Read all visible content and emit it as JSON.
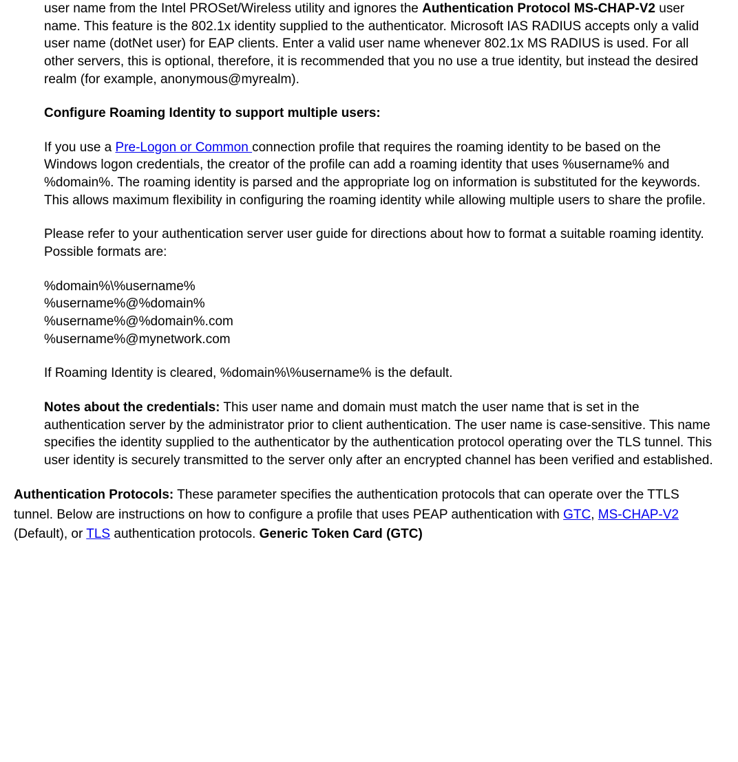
{
  "para1": {
    "before_bold": "user name from the Intel PROSet/Wireless utility and ignores the ",
    "bold": "Authentication Protocol MS-CHAP-V2",
    "after_bold": " user name. This feature is the 802.1x identity supplied to the authenticator. Microsoft IAS RADIUS accepts only a valid user name (dotNet user) for EAP clients. Enter a valid user name whenever 802.1x MS RADIUS is used. For all other servers, this is optional, therefore, it is recommended that you no use a true identity, but instead the desired realm (for example, anonymous@myrealm)."
  },
  "heading_roaming": "Configure Roaming Identity to support multiple users:",
  "para2": {
    "before_link": "If you use a ",
    "link_text": "Pre-Logon or Common ",
    "after_link": "connection profile that requires the roaming identity to be based on the Windows logon credentials, the creator of the profile can add a roaming identity that uses %username% and %domain%. The roaming identity is parsed and the appropriate log on information is substituted for the keywords.  This allows maximum flexibility in configuring the roaming identity while allowing multiple users to share the profile."
  },
  "para3": "Please refer to your authentication server user guide for directions about how to format a suitable roaming identity.  Possible formats are:",
  "formats": {
    "f1": "%domain%\\%username%",
    "f2": "%username%@%domain%",
    "f3": "%username%@%domain%.com",
    "f4": "%username%@mynetwork.com"
  },
  "para4": "If Roaming Identity is cleared, %domain%\\%username% is the default.",
  "para5": {
    "bold": "Notes about the credentials:",
    "text": " This user name and domain must match the user name that is set in the authentication server by the administrator prior to client authentication. The user name is case-sensitive. This name specifies the identity supplied to the authenticator by the authentication protocol operating over the TLS tunnel. This user identity is securely transmitted to the server only after an encrypted channel has been verified and established."
  },
  "para6": {
    "bold1": "Authentication Protocols:",
    "text1": " These parameter specifies the authentication protocols that can operate over the TTLS tunnel. Below are instructions on how to configure a profile that uses PEAP authentication with ",
    "link1": "GTC",
    "sep1": ", ",
    "link2": "MS-CHAP-V2",
    "text2": " (Default), or ",
    "link3": "TLS",
    "text3": " authentication protocols. ",
    "bold2": "Generic Token Card (GTC)"
  }
}
